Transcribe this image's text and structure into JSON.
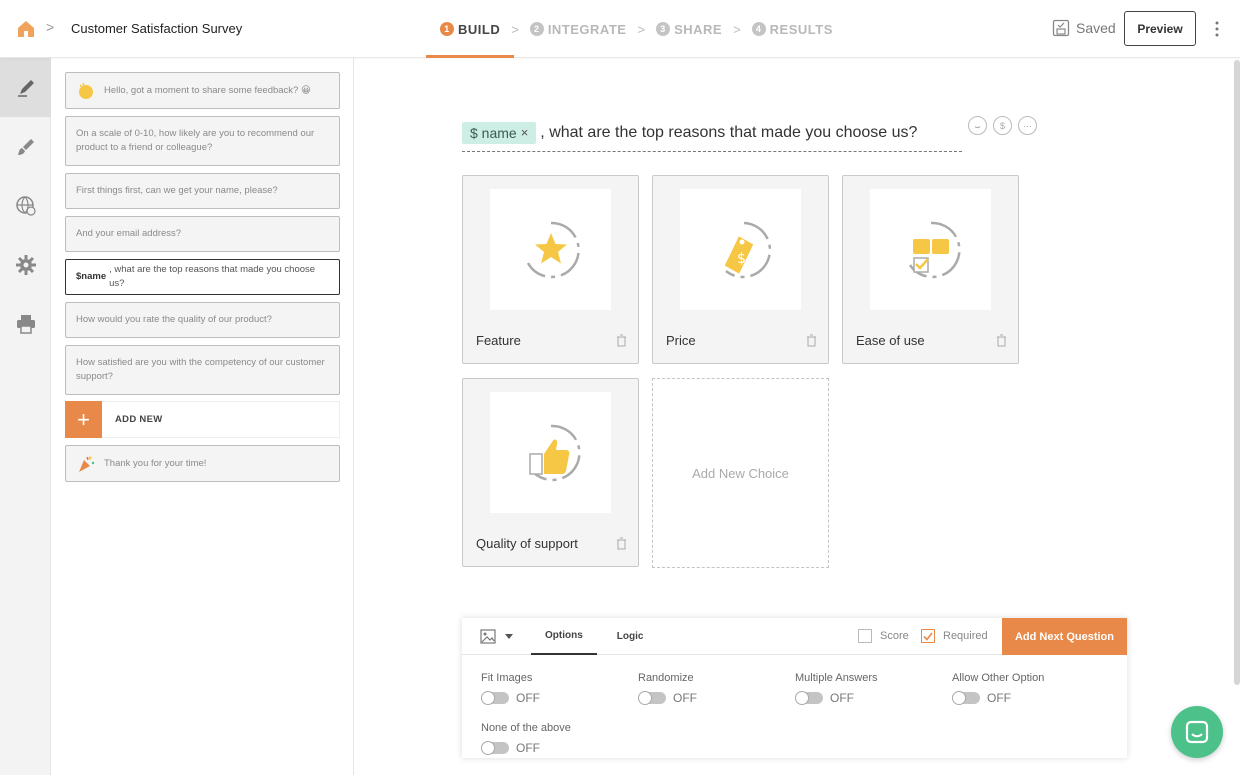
{
  "header": {
    "survey_title": "Customer Satisfaction Survey",
    "steps": [
      {
        "num": "1",
        "label": "BUILD"
      },
      {
        "num": "2",
        "label": "INTEGRATE"
      },
      {
        "num": "3",
        "label": "SHARE"
      },
      {
        "num": "4",
        "label": "RESULTS"
      }
    ],
    "saved_label": "Saved",
    "preview_label": "Preview"
  },
  "questions": {
    "items": [
      {
        "text": "Hello, got a moment to share some feedback? 😀"
      },
      {
        "text": "On a scale of 0-10, how likely are you to recommend our product to a friend or colleague?"
      },
      {
        "text": "First things first, can we get your name, please?"
      },
      {
        "text": "And your email address?"
      },
      {
        "token": "$name",
        "text": ", what are the top reasons that made you choose us?"
      },
      {
        "text": "How would you rate the quality of our product?"
      },
      {
        "text": "How satisfied are you with the competency of our customer support?"
      }
    ],
    "add_new_label": "ADD NEW",
    "thank_you": "Thank you for your time!"
  },
  "editor": {
    "token_label": "$ name",
    "token_remove": "×",
    "question_text": ", what are the top reasons that made you choose us?",
    "choices": [
      {
        "label": "Feature",
        "icon": "star-icon"
      },
      {
        "label": "Price",
        "icon": "price-tag-icon"
      },
      {
        "label": "Ease of use",
        "icon": "ease-of-use-icon"
      },
      {
        "label": "Quality of support",
        "icon": "thumbs-up-icon"
      }
    ],
    "add_choice_label": "Add New Choice"
  },
  "options": {
    "tabs": [
      "Options",
      "Logic"
    ],
    "score_label": "Score",
    "score_checked": false,
    "required_label": "Required",
    "required_checked": true,
    "add_next_label": "Add Next Question",
    "toggles": [
      {
        "label": "Fit Images",
        "state": "OFF"
      },
      {
        "label": "Randomize",
        "state": "OFF"
      },
      {
        "label": "Multiple Answers",
        "state": "OFF"
      },
      {
        "label": "Allow Other Option",
        "state": "OFF"
      },
      {
        "label": "None of the above",
        "state": "OFF"
      }
    ]
  },
  "colors": {
    "accent": "#e8894a",
    "token_bg": "#cdeee5",
    "icon_yellow": "#f6c744",
    "chat": "#4cc18a"
  }
}
